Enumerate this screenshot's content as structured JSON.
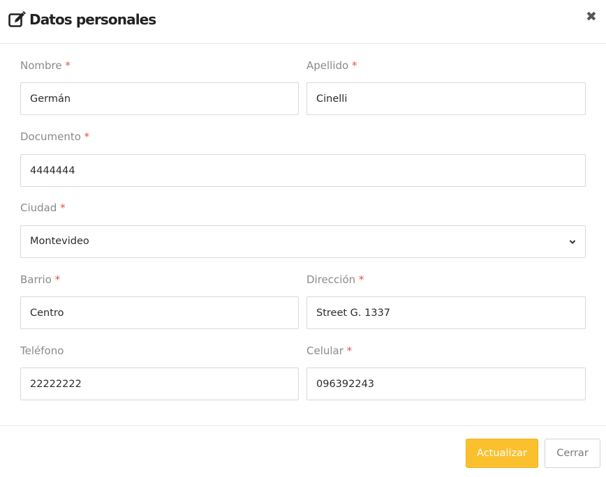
{
  "header": {
    "title": "Datos personales",
    "close_symbol": "✖"
  },
  "form": {
    "nombre": {
      "label": "Nombre",
      "required": "*",
      "value": "Germán"
    },
    "apellido": {
      "label": "Apellido",
      "required": "*",
      "value": "Cinelli"
    },
    "documento": {
      "label": "Documento",
      "required": "*",
      "value": "4444444"
    },
    "ciudad": {
      "label": "Ciudad",
      "required": "*",
      "value": "Montevideo"
    },
    "barrio": {
      "label": "Barrio",
      "required": "*",
      "value": "Centro"
    },
    "direccion": {
      "label": "Dirección",
      "required": "*",
      "value": "Street G. 1337"
    },
    "telefono": {
      "label": "Teléfono",
      "value": "22222222"
    },
    "celular": {
      "label": "Celular",
      "required": "*",
      "value": "096392243"
    }
  },
  "footer": {
    "update_label": "Actualizar",
    "close_label": "Cerrar"
  },
  "colors": {
    "primary": "#fbc02d",
    "required": "#e5534b",
    "label": "#8a8a8a"
  },
  "icons": {
    "title_icon": "edit-icon",
    "close_icon": "close-icon",
    "select_icon": "chevron-down-icon"
  }
}
